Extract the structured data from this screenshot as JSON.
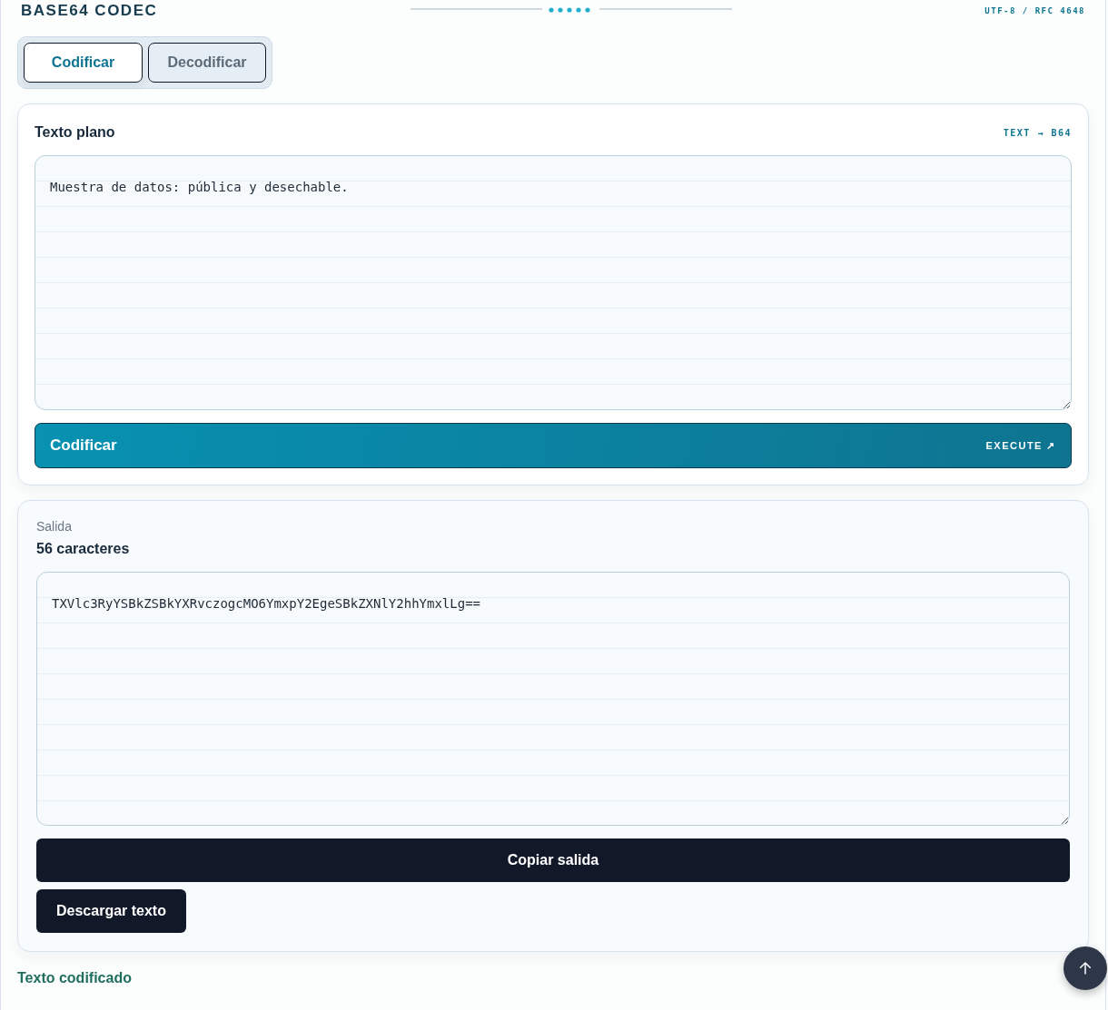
{
  "header": {
    "title": "BASE64 CODEC",
    "standard": "UTF-8 / RFC 4648"
  },
  "tabs": [
    {
      "label": "Codificar",
      "selected": true
    },
    {
      "label": "Decodificar",
      "selected": false
    }
  ],
  "input_card": {
    "title": "Texto plano",
    "tag": "TEXT → B64",
    "value": "Muestra de datos: pública y desechable.",
    "action": {
      "label": "Codificar",
      "hint": "EXECUTE ↗"
    }
  },
  "output_card": {
    "label": "Salida",
    "count": "56 caracteres",
    "value": "TXVlc3RyYSBkZSBkYXRvczogcMO6YmxpY2EgeSBkZXNlY2hhYmxlLg==",
    "buttons": [
      "Copiar salida",
      "Descargar texto"
    ]
  },
  "footer": {
    "status": "Texto codificado"
  }
}
